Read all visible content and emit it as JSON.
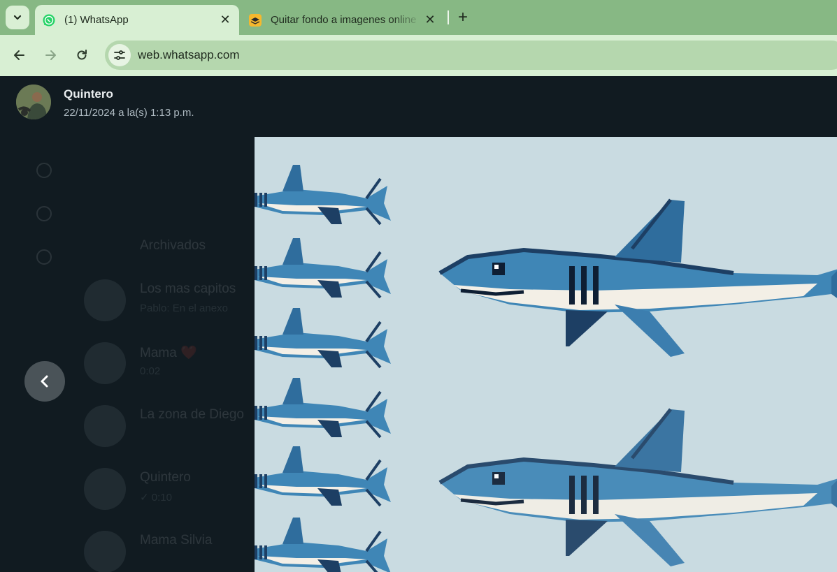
{
  "browser": {
    "tabs": [
      {
        "title": "(1) WhatsApp",
        "active": true,
        "favicon": "whatsapp-icon"
      },
      {
        "title": "Quitar fondo a imagenes online",
        "active": false,
        "favicon": "layers-icon"
      }
    ],
    "new_tab_label": "+",
    "close_label": "✕",
    "url": "web.whatsapp.com"
  },
  "viewer": {
    "sender_name": "Quintero",
    "timestamp": "22/11/2024 a la(s) 1:13 p.m."
  },
  "background_chats": {
    "archived_label": "Archivados",
    "rows": [
      {
        "name": "Los mas capitos",
        "preview": "Pablo: En el anexo"
      },
      {
        "name": "Mama ❤️",
        "preview": "0:02"
      },
      {
        "name": "La zona de Diego",
        "preview": ""
      },
      {
        "name": "Quintero",
        "preview": "✓ 0:10"
      },
      {
        "name": "Mama Silvia",
        "preview": ""
      }
    ]
  },
  "colors": {
    "tabbar": "#87b884",
    "toolbar": "#d8efd3",
    "viewer_bg": "#111b21",
    "image_bg": "#c9dbe1",
    "shark_blue": "#3f86b6",
    "shark_dark": "#1d3f64"
  }
}
